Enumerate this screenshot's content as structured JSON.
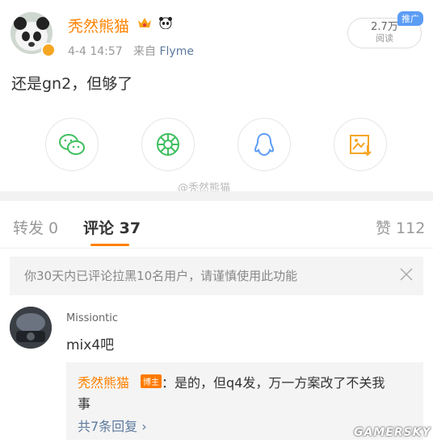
{
  "post": {
    "author": "秃然熊猫",
    "time": "4-4 14:57",
    "source_prefix": "来自",
    "source": "Flyme",
    "views_count": "2.7万",
    "views_label": "阅读",
    "promo_badge": "推广",
    "text": "还是gn2，但够了"
  },
  "share": {
    "items": [
      {
        "icon": "wechat-icon",
        "color": "#3fbf5f"
      },
      {
        "icon": "moments-icon",
        "color": "#3fbf5f"
      },
      {
        "icon": "qq-icon",
        "color": "#5b9cf5"
      },
      {
        "icon": "save-image-icon",
        "color": "#f5a623"
      }
    ]
  },
  "watermark": "@秃然熊猫",
  "tabs": {
    "repost": "转发 0",
    "comment_label": "评论",
    "comment_count": "37",
    "like": "赞 112"
  },
  "notice": {
    "text": "你30天内已评论拉黑10名用户，请谨慎使用此功能"
  },
  "comment": {
    "user": "Missiontic",
    "text": "mix4吧",
    "reply": {
      "user": "秃然熊猫",
      "badge": "博主",
      "text_line1": "：是的，但q4发，万一方案改了不关我",
      "text_line2": "事",
      "more": "共7条回复 ›"
    }
  },
  "site_watermark": "GAMERSKY",
  "colors": {
    "accent": "#ff8200",
    "link": "#5d7a9e",
    "promo": "#5b9cf5"
  }
}
